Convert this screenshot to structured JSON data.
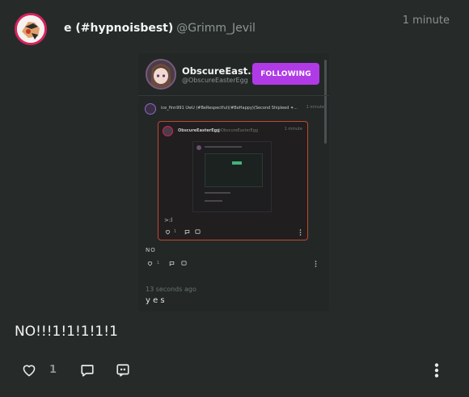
{
  "post": {
    "display_name": "e (#hypnoisbest)",
    "handle": "@Grimm_Jevil",
    "time": "1 minute",
    "text": "NO!!!1!1!1!1!1",
    "like_count": "1"
  },
  "embedded_screenshot": {
    "profile_name": "ObscureEast...",
    "profile_handle": "@ObscureEasterEgg",
    "follow_label": "FOLLOWING",
    "reply_author": "ice_finn991 UwU (#BeRespectful)(#BeHappy)(Second Shipleed ✦...",
    "reply_time": "1 minute",
    "inner_name": "ObscureEasterEgg",
    "inner_handle": "@ObscureEasterEgg",
    "inner_time": "1 minute",
    "inner_text": ">:l",
    "inner_like_count": "1",
    "no_text": "NO",
    "no_like_count": "1",
    "timestamp": "13 seconds ago",
    "yes_text": "y e s"
  },
  "icons": [
    "heart-icon",
    "reply-icon",
    "quote-icon",
    "more-icon"
  ],
  "colors": {
    "background": "#262b2a",
    "avatar_ring": "#d6235f",
    "follow_button": "#b03be6",
    "inner_border": "#c0482e"
  }
}
